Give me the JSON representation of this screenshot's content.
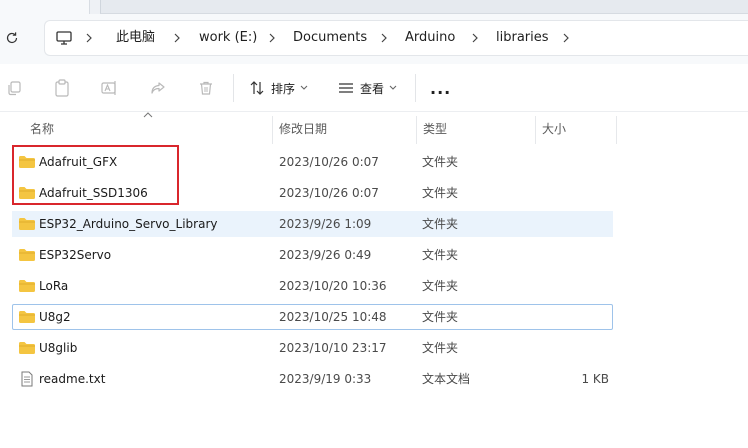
{
  "breadcrumb": {
    "items": [
      "此电脑",
      "work (E:)",
      "Documents",
      "Arduino",
      "libraries"
    ]
  },
  "toolbar": {
    "sort_label": "排序",
    "view_label": "查看",
    "more_label": "..."
  },
  "columns": {
    "name": "名称",
    "modified": "修改日期",
    "type": "类型",
    "size": "大小"
  },
  "files": [
    {
      "name": "Adafruit_GFX",
      "modified": "2023/10/26 0:07",
      "type": "文件夹",
      "size": "",
      "icon": "folder-icon"
    },
    {
      "name": "Adafruit_SSD1306",
      "modified": "2023/10/26 0:07",
      "type": "文件夹",
      "size": "",
      "icon": "folder-icon"
    },
    {
      "name": "ESP32_Arduino_Servo_Library",
      "modified": "2023/9/26 1:09",
      "type": "文件夹",
      "size": "",
      "icon": "folder-icon",
      "state": "selected"
    },
    {
      "name": "ESP32Servo",
      "modified": "2023/9/26 0:49",
      "type": "文件夹",
      "size": "",
      "icon": "folder-icon"
    },
    {
      "name": "LoRa",
      "modified": "2023/10/20 10:36",
      "type": "文件夹",
      "size": "",
      "icon": "folder-icon"
    },
    {
      "name": "U8g2",
      "modified": "2023/10/25 10:48",
      "type": "文件夹",
      "size": "",
      "icon": "folder-icon",
      "state": "focused"
    },
    {
      "name": "U8glib",
      "modified": "2023/10/10 23:17",
      "type": "文件夹",
      "size": "",
      "icon": "folder-icon"
    },
    {
      "name": "readme.txt",
      "modified": "2023/9/19 0:33",
      "type": "文本文档",
      "size": "1 KB",
      "icon": "text-file-icon"
    }
  ],
  "colors": {
    "folder": "#f4c541",
    "highlight_box": "#d9262c",
    "selection": "#eaf3fc",
    "focus_border": "#9ec3ea"
  }
}
